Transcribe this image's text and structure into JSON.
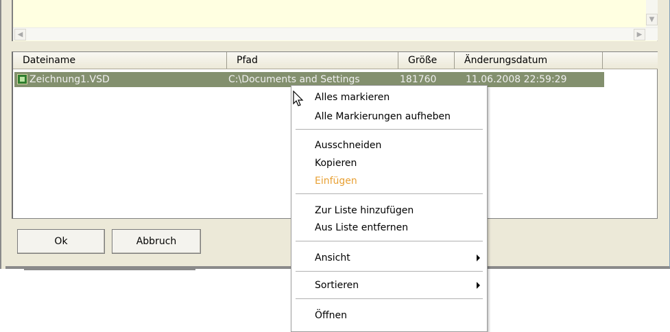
{
  "columns": [
    "Dateiname",
    "Pfad",
    "Größe",
    "Änderungsdatum"
  ],
  "row": {
    "filename": "Zeichnung1.VSD",
    "path": "C:\\Documents and Settings",
    "size": "181760",
    "date": "11.06.2008 22:59:29"
  },
  "buttons": {
    "ok": "Ok",
    "cancel": "Abbruch"
  },
  "menu": {
    "select_all": "Alles markieren",
    "deselect_all": "Alle Markierungen aufheben",
    "cut": "Ausschneiden",
    "copy": "Kopieren",
    "paste": "Einfügen",
    "add_to_list": "Zur Liste hinzufügen",
    "remove_from_list": "Aus Liste entfernen",
    "view": "Ansicht",
    "sort": "Sortieren",
    "open": "Öffnen"
  },
  "colors": {
    "selection": "#83906e",
    "disabled_text": "#e8a033",
    "memo_bg": "#ffffe1"
  }
}
